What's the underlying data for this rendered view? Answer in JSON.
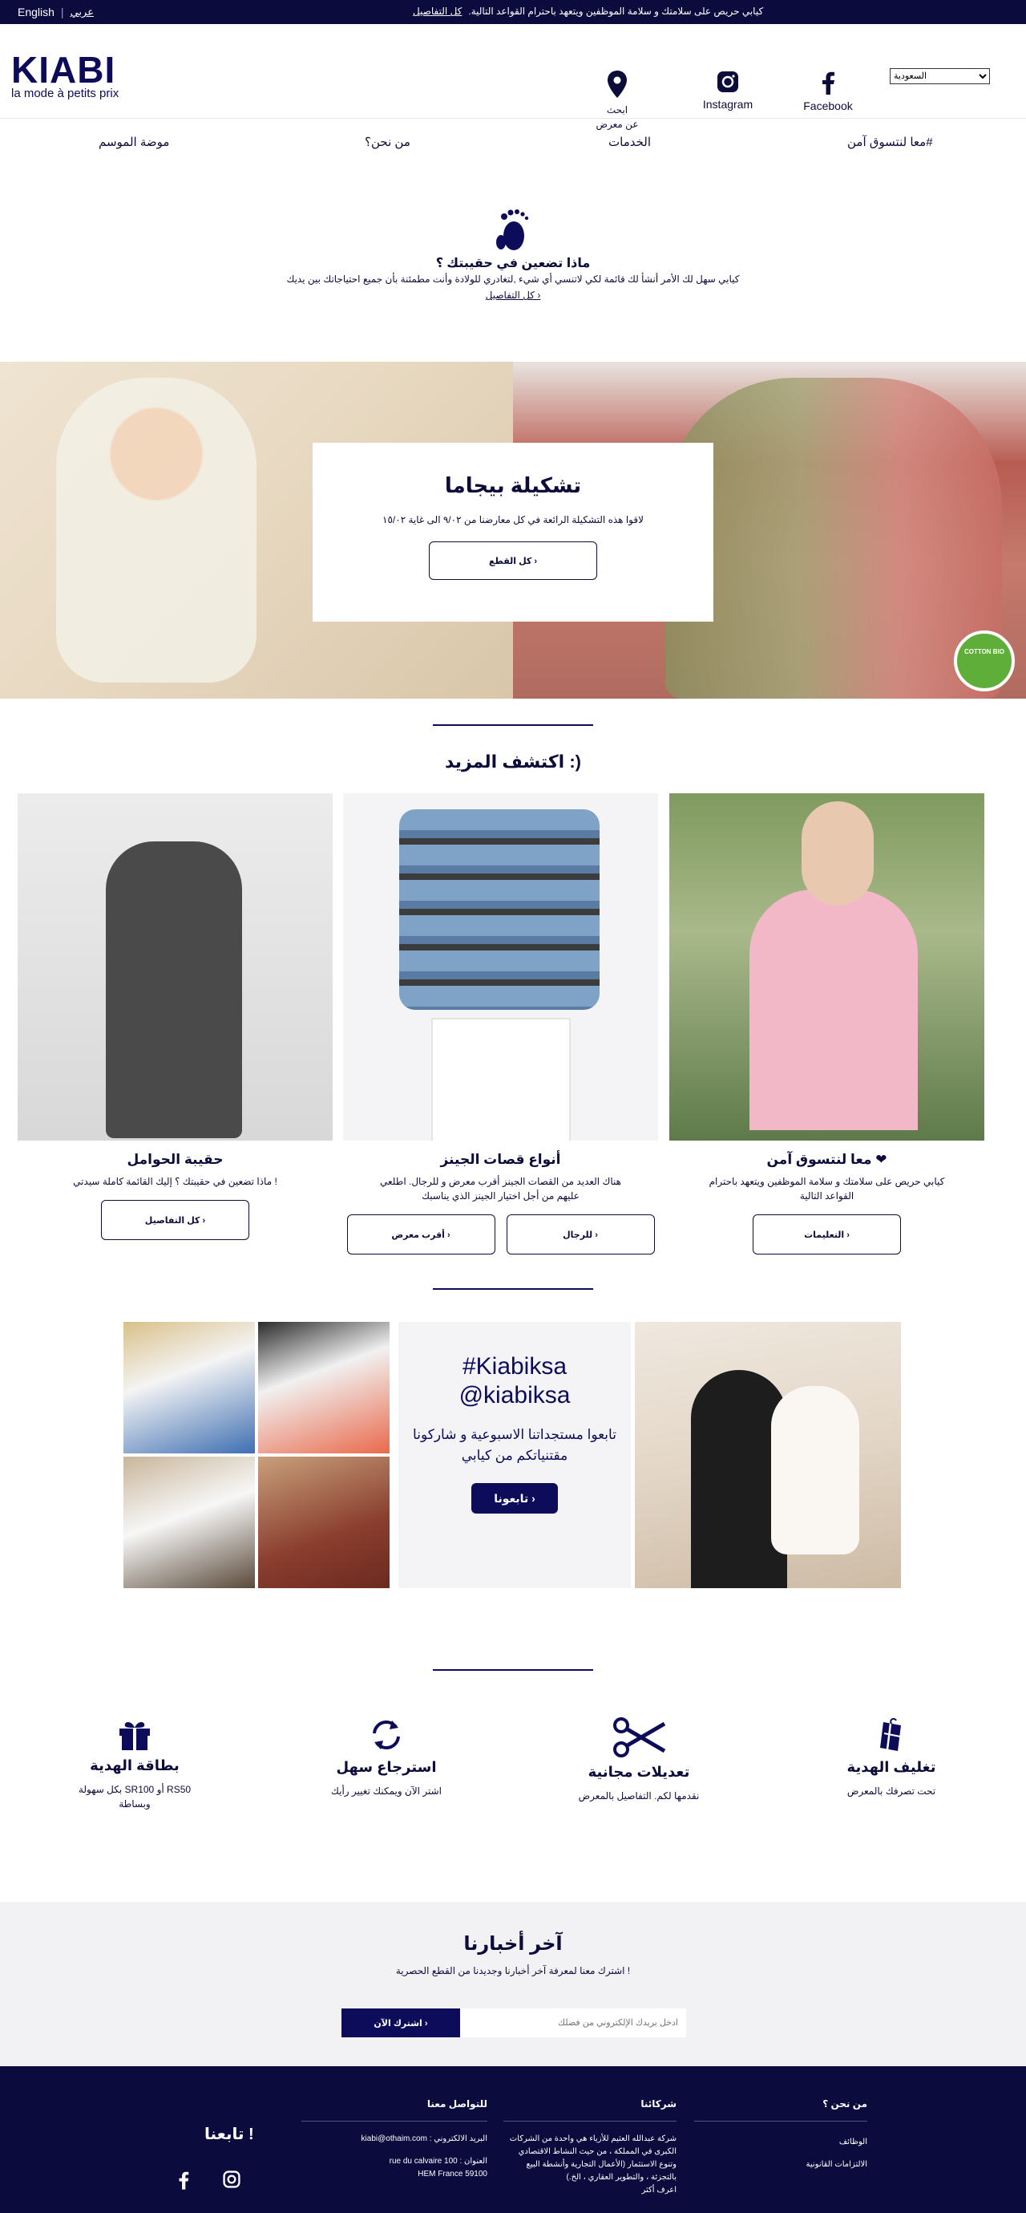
{
  "topbar": {
    "lang_en": "English",
    "lang_ar": "عربي",
    "message": "كيابي حريص على سلامتك و سلامة الموظفين ويتعهد باحترام القواعد التالية.",
    "details_link": "كل التفاصيل"
  },
  "header": {
    "logo_text": "KIABI",
    "logo_tagline": "la mode à petits prix",
    "store_finder": "ابحث\nعن معرض",
    "instagram": "Instagram",
    "facebook": "Facebook",
    "country_select": "السعودية"
  },
  "nav": {
    "items": [
      "معا لنتسوق آمن#",
      "الخدمات",
      "من نحن؟",
      "موضة الموسم"
    ]
  },
  "intro": {
    "title": "ماذا تضعين في حقيبتك ؟",
    "text": "كيابي سهل لك الأمر أنشأ لك قائمة لكي لاتنسي أي شيء ,لتغادري للولادة وأنت مطمئنة بأن جميع احتياجاتك بين يديك",
    "link": "كل التفاصيل ›"
  },
  "hero": {
    "title": "تشكيلة بيجاما",
    "text": "لاقوا هذه التشكيلة الرائعة في كل معارضنا من ٩/٠٢ الى غاية ١٥/٠٢",
    "button": "كل القطع ›",
    "badge": "COTTON BIO"
  },
  "discover": {
    "title": "اكتشف المزيد :)",
    "cards": [
      {
        "title": "حقيبة الحوامل",
        "text": "ماذا تضعين في حقيبتك ؟ إليك القائمة كاملة سيدتي !",
        "buttons": [
          "كل التفاصيل ›"
        ]
      },
      {
        "title": "أنواع قصات الجينز",
        "text": "هناك العديد من القصات الجينز أقرب معرض و للرجال. اطلعي عليهم من أجل اختيار الجينز الذي يناسبك",
        "buttons": [
          "أقرب معرض ›",
          "للرجال ›"
        ]
      },
      {
        "title": "معا لنتسوق آمن ❤",
        "text": "كيابي حريص على سلامتك و سلامة الموظفين ويتعهد باحترام القواعد التالية",
        "buttons": [
          "التعليمات ›"
        ]
      }
    ]
  },
  "social": {
    "hashtag": "#Kiabiksa",
    "handle": "@kiabiksa",
    "text": "تابعوا مستجداتنا الاسبوعية و شاركونا مقتنياتكم من كيابي",
    "button": "تابعونا ›"
  },
  "services": [
    {
      "title": "بطاقة الهدية",
      "text": "بكل سهولة SR100 أو RS50 وبساطة",
      "icon": "gift-icon"
    },
    {
      "title": "استرجاع سهل",
      "text": "اشتر الآن ويمكنك تغيير رأيك",
      "icon": "refresh-icon"
    },
    {
      "title": "تعديلات مجانية",
      "text": "نقدمها لكم. التفاصيل بالمعرض",
      "icon": "scissors-icon"
    },
    {
      "title": "تغليف الهدية",
      "text": "تحت تصرفك بالمعرض",
      "icon": "gift-wrap-icon"
    }
  ],
  "newsletter": {
    "title": "آخر أخبارنا",
    "text": "اشترك معنا لمعرفة آخر أخبارنا وجديدنا من القطع الحصرية !",
    "button": "اشترك الآن ›",
    "placeholder": "ادخل بريدك الإلكتروني من فضلك"
  },
  "footer": {
    "follow": "تابعنا !",
    "contact_title": "للتواصل معنا",
    "contact_email": "البريد الالكتروني : kiabi@othaim.com",
    "contact_address1": "العنوان : 100 rue du calvaire",
    "contact_address2": "59100 HEM France",
    "partners_title": "شركائنا",
    "partners_text": "شركة عبدالله العثيم للأزياء هي واحدة من الشركات الكبرى في المملكة ، من حيث النشاط الاقتصادي وتنوع الاستثمار (الأعمال التجارية وأنشطة البيع بالتجزئة ، والتطوير العقاري ، الخ.)",
    "partners_more": "اعرف أكثر",
    "about_title": "من نحن ؟",
    "about_links": [
      "الوظائف",
      "الالتزامات القانونية"
    ]
  },
  "colors": {
    "brand_navy": "#0c0c5a",
    "topbar": "#0b0b3e",
    "cotton_badge": "#5fae3a"
  }
}
